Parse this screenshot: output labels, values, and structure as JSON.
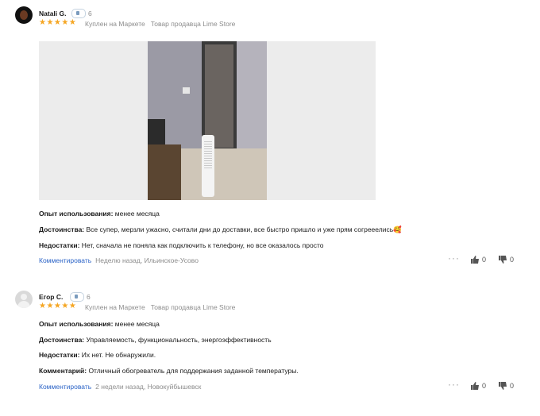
{
  "reviews": [
    {
      "author": "Natali G.",
      "badge_count": "6",
      "stars": "★★★★★",
      "bought": "Куплен на Маркете",
      "seller": "Товар продавца Lime Store",
      "lines": [
        {
          "label": "Опыт использования:",
          "text": " менее месяца"
        },
        {
          "label": "Достоинства:",
          "text": " Все супер, мерзли ужасно, считали дни до доставки, все быстро пришло и уже прям согрееелись🥰"
        },
        {
          "label": "Недостатки:",
          "text": " Нет, сначала не поняла как подключить к телефону, но все оказалось просто"
        }
      ],
      "comment_label": "Комментировать",
      "when": "Неделю назад, Ильинское-Усово",
      "likes": "0",
      "dislikes": "0"
    },
    {
      "author": "Егор С.",
      "badge_count": "6",
      "stars": "★★★★★",
      "bought": "Куплен на Маркете",
      "seller": "Товар продавца Lime Store",
      "lines": [
        {
          "label": "Опыт использования:",
          "text": " менее месяца"
        },
        {
          "label": "Достоинства:",
          "text": " Управляемость, функциональность, энергоэффективность"
        },
        {
          "label": "Недостатки:",
          "text": " Их нет. Не обнаружили."
        },
        {
          "label": "Комментарий:",
          "text": " Отличный обогреватель для поддержания заданной температуры."
        }
      ],
      "comment_label": "Комментировать",
      "when": "2 недели назад, Новокуйбышевск",
      "likes": "0",
      "dislikes": "0"
    }
  ],
  "icons": {
    "more": "more-dots-icon",
    "like": "thumb-up-icon",
    "dislike": "thumb-down-icon"
  },
  "colors": {
    "stars": "#f5a623",
    "link": "#2c64c7",
    "muted": "#8c8c8c"
  }
}
